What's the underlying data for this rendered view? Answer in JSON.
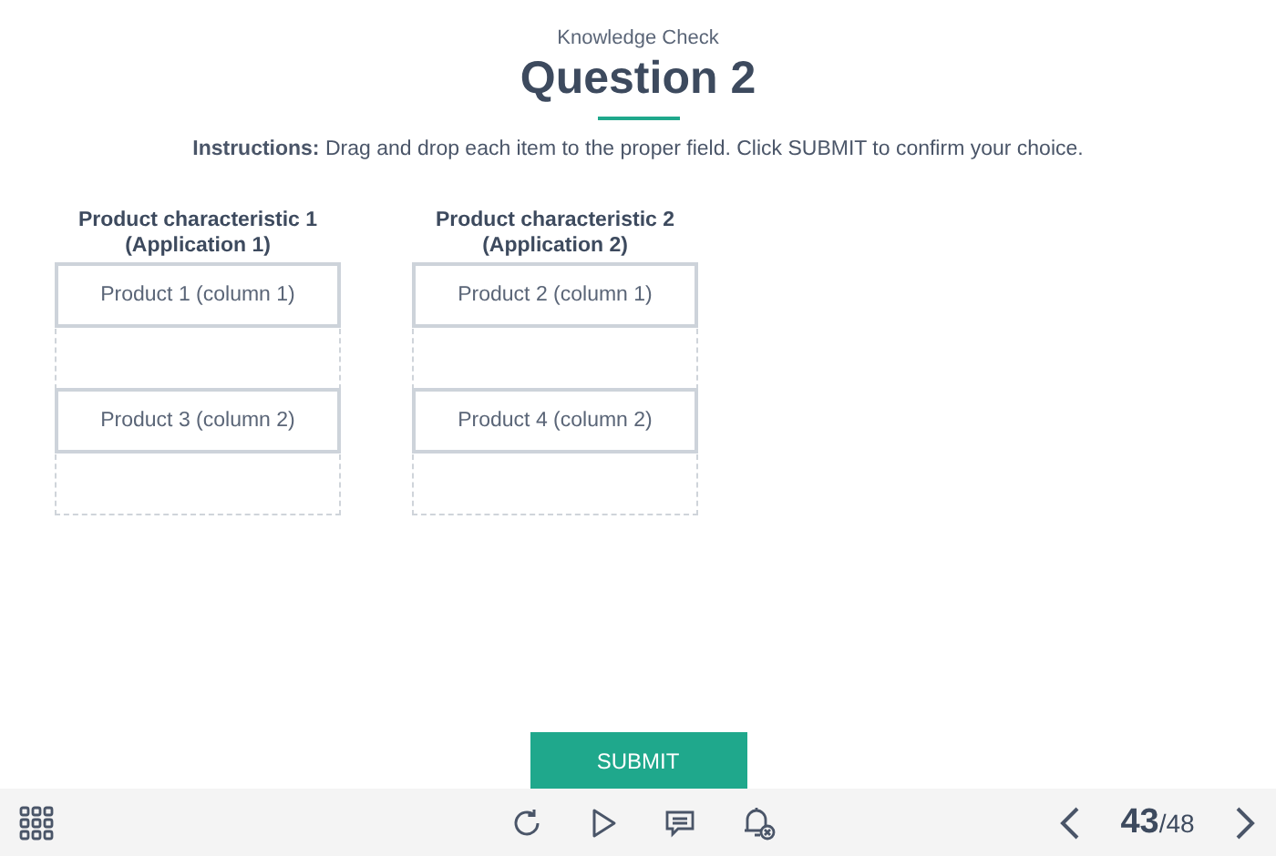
{
  "header": {
    "subtitle": "Knowledge Check",
    "title": "Question 2"
  },
  "instructions": "**Instructions:** Drag and drop each item to the proper field. Click SUBMIT to confirm your choice.",
  "columns": [
    {
      "heading": "Product characteristic 1 (Application 1)",
      "items": [
        "Product 1 (column 1)",
        "Product 3 (column 2)"
      ]
    },
    {
      "heading": "Product characteristic 2 (Application 2)",
      "items": [
        "Product 2 (column 1)",
        "Product 4 (column 2)"
      ]
    }
  ],
  "submit": "SUBMIT",
  "footer": {
    "current": "43",
    "total": "/48"
  }
}
